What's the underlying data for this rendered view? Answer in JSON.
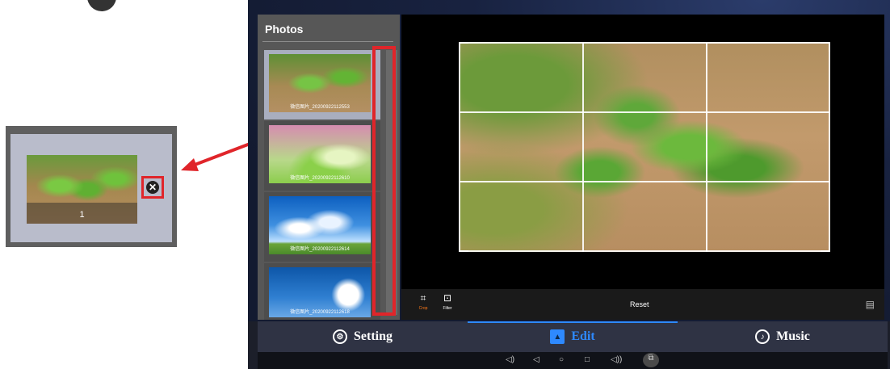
{
  "photos_panel": {
    "title": "Photos",
    "items": [
      {
        "caption": "微信图片_20200922112553",
        "close_icon": "close-icon"
      },
      {
        "caption": "微信图片_20200922112610",
        "close_icon": "close-icon"
      },
      {
        "caption": "微信图片_20200922112614",
        "close_icon": "close-icon"
      },
      {
        "caption": "微信图片_20200922112618",
        "close_icon": "close-icon"
      }
    ]
  },
  "zoom_callout": {
    "thumbnail_number": "1"
  },
  "toolbar": {
    "crop_label": "Crop",
    "filter_label": "Filter",
    "reset_label": "Reset"
  },
  "tabs": {
    "setting": "Setting",
    "edit": "Edit",
    "music": "Music"
  },
  "colors": {
    "accent": "#2e89ff",
    "highlight": "#e0252a",
    "crop_active": "#ff7a1a"
  }
}
